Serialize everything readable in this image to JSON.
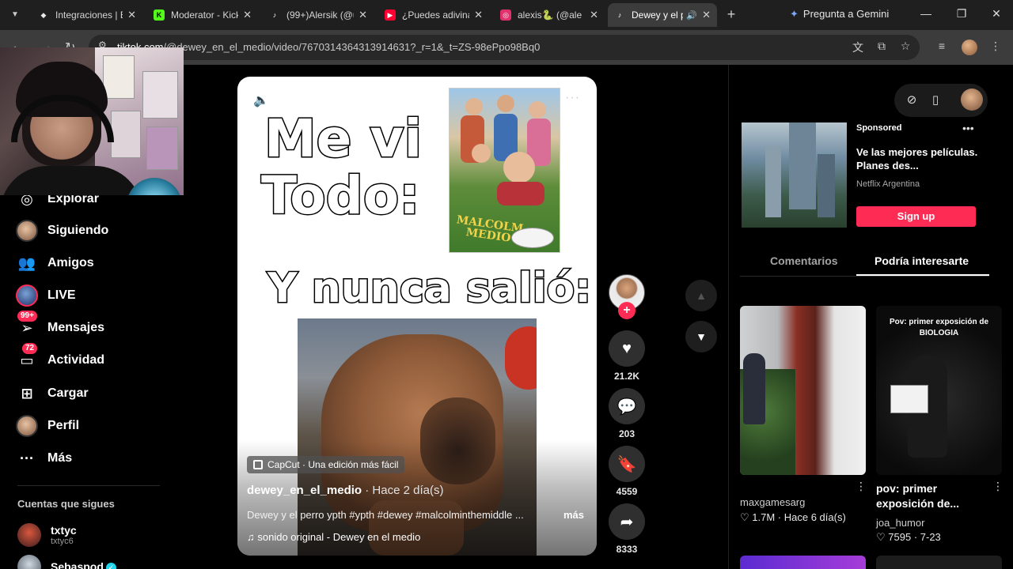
{
  "browser": {
    "tabs": [
      {
        "title": "Integraciones | E",
        "favicon": "puzzle-icon",
        "color": "#e8e8e8"
      },
      {
        "title": "Moderator - Kick",
        "favicon": "kick-icon",
        "color": "#53fc18"
      },
      {
        "title": "(99+)Alersik (@u",
        "favicon": "tiktok-icon",
        "color": "#ffffff"
      },
      {
        "title": "¿Puedes adivinar",
        "favicon": "youtube-icon",
        "color": "#ff0033"
      },
      {
        "title": "alexis🐍 (@ale",
        "favicon": "instagram-icon",
        "color": "#e1306c"
      },
      {
        "title": "Dewey y el p",
        "favicon": "tiktok-icon",
        "color": "#ffffff",
        "active": true,
        "audio": "speaker-icon"
      }
    ],
    "gemini_label": "Pregunta a Gemini",
    "url_domain": "tiktok.com",
    "url_path": "/@dewey_en_el_medio/video/7670314364313914631?_r=1&_t=ZS-98ePpo98Bq0"
  },
  "sidebar": {
    "items": [
      {
        "label": "Explorar",
        "icon": "compass-icon"
      },
      {
        "label": "Siguiendo",
        "icon": "following-avatar"
      },
      {
        "label": "Amigos",
        "icon": "friends-icon"
      },
      {
        "label": "LIVE",
        "icon": "live-avatar"
      },
      {
        "label": "Mensajes",
        "icon": "messages-icon",
        "badge": "99+"
      },
      {
        "label": "Actividad",
        "icon": "activity-icon",
        "badge": "72"
      },
      {
        "label": "Cargar",
        "icon": "upload-icon"
      },
      {
        "label": "Perfil",
        "icon": "profile-avatar"
      },
      {
        "label": "Más",
        "icon": "more-icon"
      }
    ],
    "following_header": "Cuentas que sigues",
    "following": [
      {
        "name": "txtyc",
        "handle": "txtyc6"
      },
      {
        "name": "Sebaspod",
        "verified": true
      }
    ]
  },
  "video": {
    "overlay_line1": "Me vi",
    "overlay_line2": "Todo:",
    "overlay_line3": "Y nunca salió:",
    "poster_title": "MALCOLM MEDIO",
    "capcut": "CapCut · Una edición más fácil",
    "author": "dewey_en_el_medio",
    "posted": "· Hace 2 día(s)",
    "description": "Dewey y el perro ypth #ypth #dewey #malcolminthemiddle ...",
    "more": "más",
    "sound": "♫  sonido original - Dewey en el medio"
  },
  "actions": {
    "likes": "21.2K",
    "comments": "203",
    "saves": "4559",
    "shares": "8333"
  },
  "right_panel": {
    "ad": {
      "sponsored": "Sponsored",
      "title": "Ve las mejores películas. Planes des...",
      "brand": "Netflix Argentina",
      "cta": "Sign up"
    },
    "tabs": [
      "Comentarios",
      "Podría interesarte"
    ],
    "cards": [
      {
        "user": "maxgamesarg",
        "likes": "1.7M",
        "date": "Hace 6 día(s)"
      },
      {
        "caption": "Pov: primer exposición de BIOLOGIA",
        "title": "pov: primer exposición de...",
        "user": "joa_humor",
        "likes": "7595",
        "date": "7-23"
      }
    ]
  },
  "colors": {
    "accent": "#fe2c55",
    "background": "#000000",
    "verified": "#20d5ec"
  }
}
